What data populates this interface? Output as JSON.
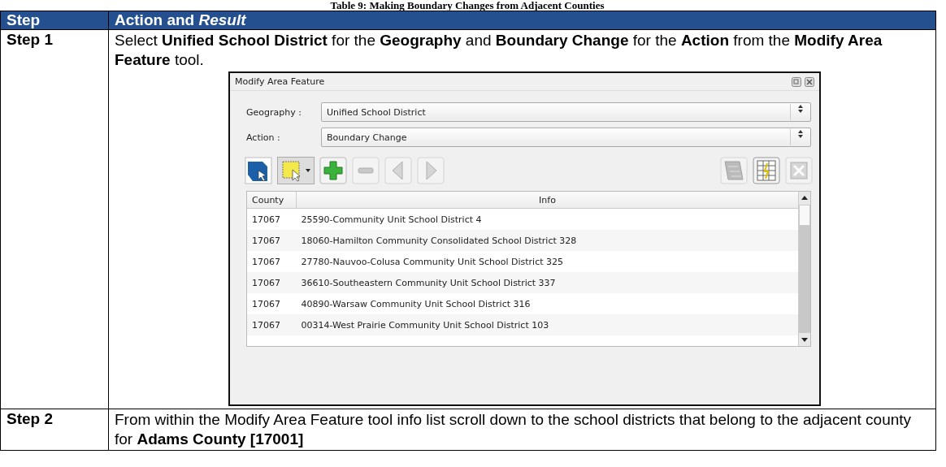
{
  "caption": "Table 9: Making Boundary Changes from Adjacent Counties",
  "table": {
    "columns": [
      "Step",
      "Action and *Result*"
    ],
    "rows": [
      {
        "step": "Step 1",
        "text": "Select **Unified School District** for the **Geography** and **Boundary Change** for the **Action** from the **Modify Area Feature** tool."
      },
      {
        "step": "Step 2",
        "text": "From within the Modify Area Feature tool info list scroll down to the school districts that belong to the adjacent county for **Adams County [17001]**"
      }
    ]
  },
  "dialog": {
    "title": "Modify Area Feature",
    "fields": [
      {
        "label": "Geography :",
        "value": "Unified School District"
      },
      {
        "label": "Action :",
        "value": "Boundary Change"
      }
    ],
    "tools": [
      {
        "kind": "select-area",
        "disabled": false
      },
      {
        "kind": "select-rect",
        "disabled": false
      },
      {
        "kind": "add",
        "disabled": false
      },
      {
        "kind": "remove",
        "disabled": true
      },
      {
        "kind": "back",
        "disabled": true
      },
      {
        "kind": "forward",
        "disabled": true
      }
    ],
    "tools_right": [
      {
        "kind": "map",
        "disabled": true
      },
      {
        "kind": "table",
        "disabled": false
      },
      {
        "kind": "close",
        "disabled": true
      }
    ],
    "list": {
      "columns": [
        "County",
        "Info"
      ],
      "rows": [
        [
          "17067",
          "25590-Community Unit School District 4"
        ],
        [
          "17067",
          "18060-Hamilton Community Consolidated School District 328"
        ],
        [
          "17067",
          "27780-Nauvoo-Colusa Community Unit School District 325"
        ],
        [
          "17067",
          "36610-Southeastern Community Unit School District 337"
        ],
        [
          "17067",
          "40890-Warsaw Community Unit School District 316"
        ],
        [
          "17067",
          "00314-West Prairie Community Unit School District 103"
        ]
      ]
    }
  }
}
